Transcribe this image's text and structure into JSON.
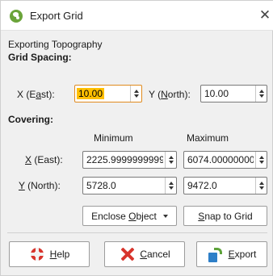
{
  "window": {
    "title": "Export Grid",
    "icon": "app-icon",
    "close_icon": "close-icon"
  },
  "exporting_label": "Exporting Topography",
  "grid_spacing": {
    "heading": "Grid Spacing:",
    "x_pre": "X (E",
    "x_key": "a",
    "x_post": "st):",
    "x_value": "10.00",
    "y_pre": "Y (",
    "y_key": "N",
    "y_post": "orth):",
    "y_value": "10.00"
  },
  "covering": {
    "heading": "Covering:",
    "min_label": "Minimum",
    "max_label": "Maximum",
    "x_key": "X",
    "x_post": " (East):",
    "y_key": "Y",
    "y_post": " (North):",
    "x_min": "2225.9999999999",
    "x_max": "6074.00000000",
    "y_min": "5728.0",
    "y_max": "9472.0"
  },
  "enclose_button": {
    "pre": "Enclose ",
    "key": "O",
    "post": "bject"
  },
  "snap_button": {
    "key": "S",
    "post": "nap to Grid"
  },
  "buttons": {
    "help": {
      "key": "H",
      "post": "elp",
      "icon": "help-icon"
    },
    "cancel": {
      "key": "C",
      "post": "ancel",
      "icon": "cancel-icon"
    },
    "export": {
      "key": "E",
      "post": "xport",
      "icon": "export-icon"
    }
  },
  "colors": {
    "focus_border": "#e08a1e",
    "selection": "#ffbf00",
    "help_icon": "#d8342c",
    "cancel_icon": "#d8342c",
    "export_icon_box": "#2e7fc8",
    "export_icon_arrow": "#5da23a",
    "app_icon": "#6ba43a"
  }
}
